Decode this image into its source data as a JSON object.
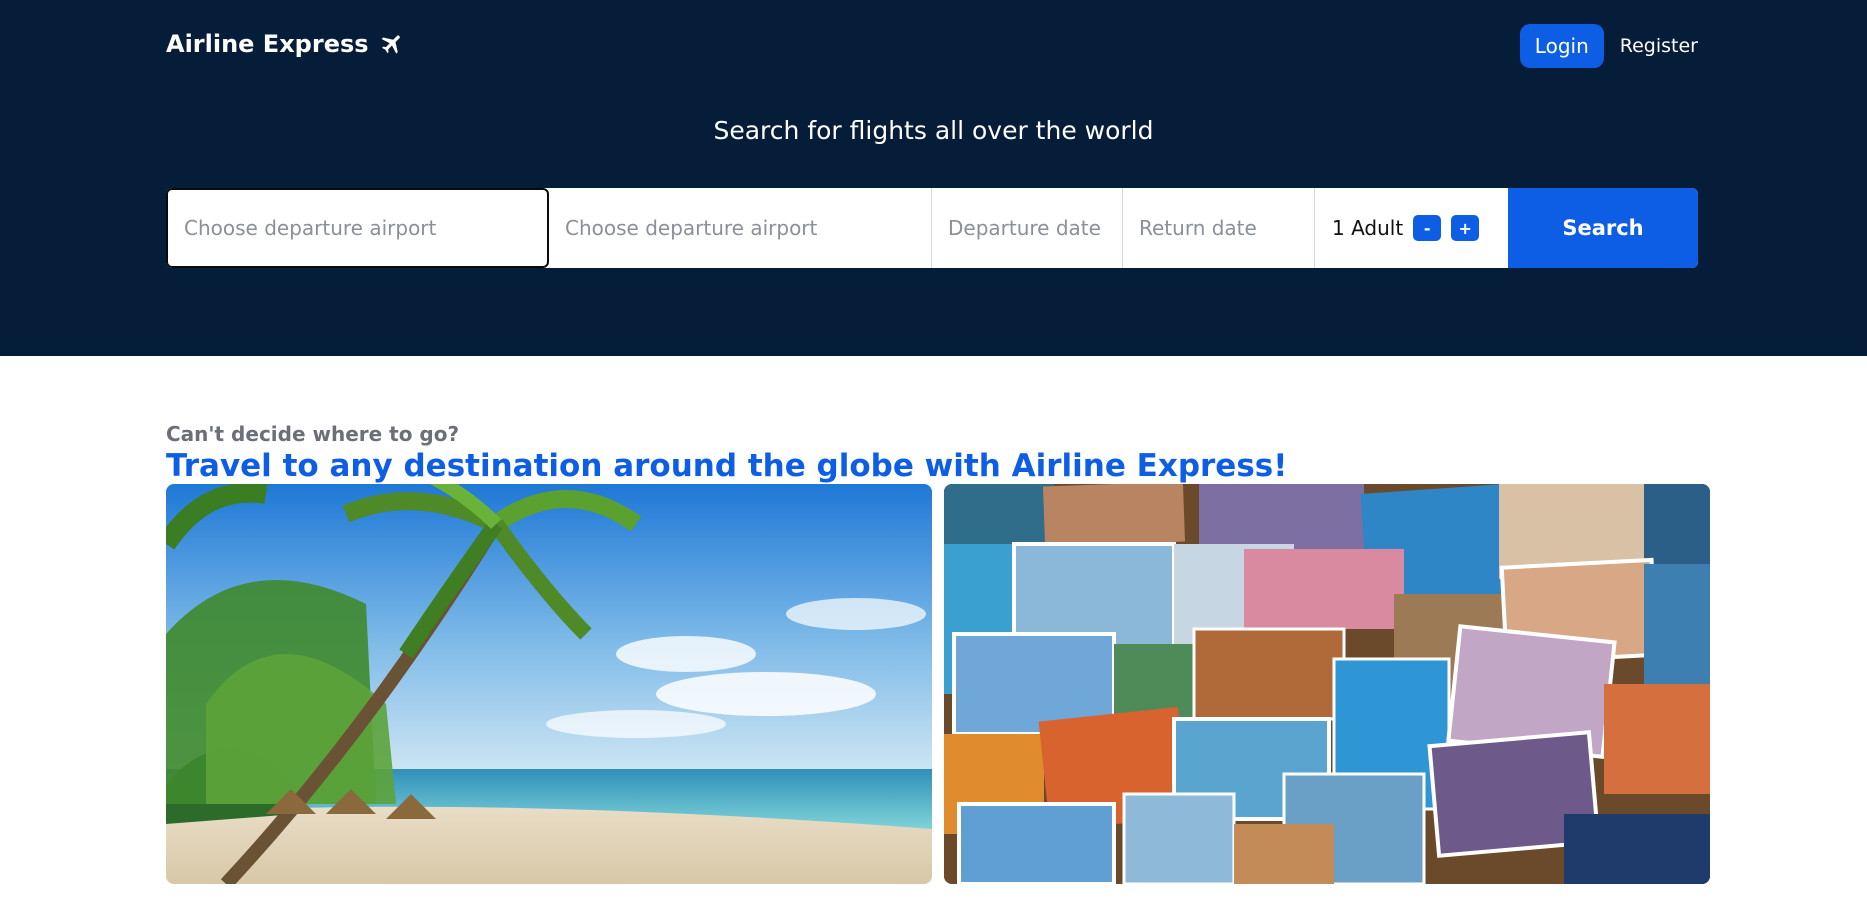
{
  "brand": {
    "name": "Airline Express",
    "icon": "airplane-icon"
  },
  "auth": {
    "login_label": "Login",
    "register_label": "Register"
  },
  "hero": {
    "title": "Search for flights all over the world"
  },
  "search": {
    "departure_placeholder": "Choose departure airport",
    "arrival_placeholder": "Choose departure airport",
    "departure_date_placeholder": "Departure date",
    "return_date_placeholder": "Return date",
    "passengers_label": "1 Adult",
    "decrement_label": "-",
    "increment_label": "+",
    "search_label": "Search"
  },
  "promo": {
    "eyebrow": "Can't decide where to go?",
    "title": "Travel to any destination around the globe with Airline Express!"
  },
  "colors": {
    "header_bg": "#061d3a",
    "accent": "#0d5ee5",
    "accent_text": "#0d5ee5",
    "muted_text": "#6a6f78"
  }
}
